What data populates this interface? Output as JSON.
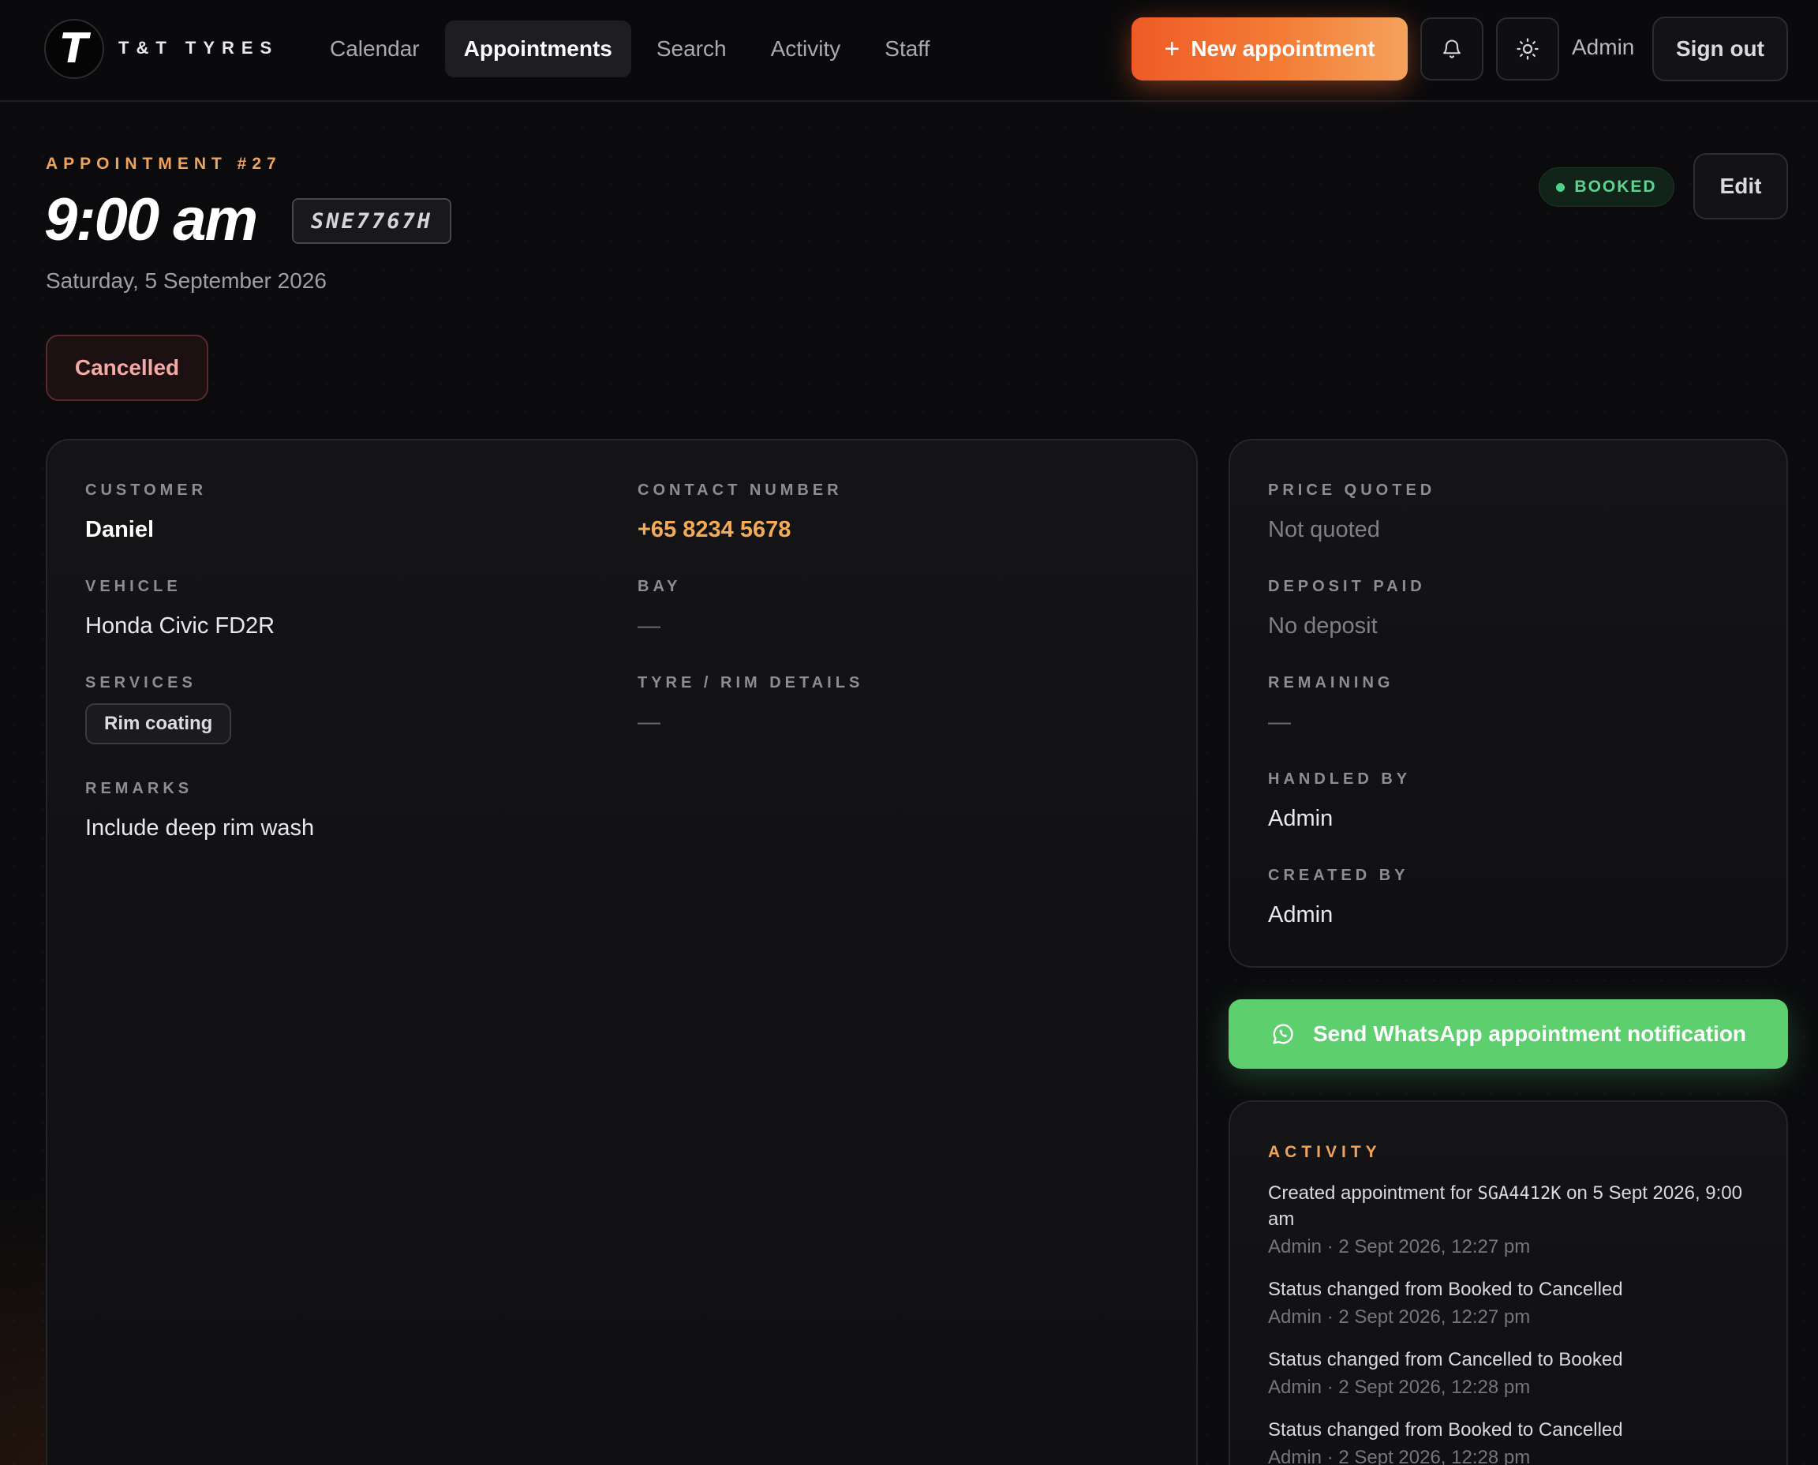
{
  "brand": {
    "logo_letter": "T",
    "name": "T&T TYRES"
  },
  "nav": {
    "items": [
      {
        "label": "Calendar",
        "active": false
      },
      {
        "label": "Appointments",
        "active": true
      },
      {
        "label": "Search",
        "active": false
      },
      {
        "label": "Activity",
        "active": false
      },
      {
        "label": "Staff",
        "active": false
      }
    ],
    "new_appointment_label": "New appointment",
    "user_label": "Admin",
    "sign_out_label": "Sign out"
  },
  "appointment": {
    "eyebrow": "APPOINTMENT #27",
    "time": "9:00 am",
    "plate": "SNE7767H",
    "date": "Saturday, 5 September 2026",
    "action_status_label": "Cancelled",
    "status_badge": "BOOKED",
    "edit_label": "Edit"
  },
  "details": {
    "customer": {
      "label": "CUSTOMER",
      "value": "Daniel"
    },
    "contact": {
      "label": "CONTACT NUMBER",
      "value": "+65 8234 5678"
    },
    "vehicle": {
      "label": "VEHICLE",
      "value": "Honda Civic FD2R"
    },
    "bay": {
      "label": "BAY",
      "value": "—"
    },
    "services": {
      "label": "SERVICES",
      "chips": [
        "Rim coating"
      ]
    },
    "tyre": {
      "label": "TYRE / RIM DETAILS",
      "value": "—"
    },
    "remarks": {
      "label": "REMARKS",
      "value": "Include deep rim wash"
    }
  },
  "side": {
    "price": {
      "label": "PRICE QUOTED",
      "value": "Not quoted"
    },
    "deposit": {
      "label": "DEPOSIT PAID",
      "value": "No deposit"
    },
    "remaining": {
      "label": "REMAINING",
      "value": "—"
    },
    "handled_by": {
      "label": "HANDLED BY",
      "value": "Admin"
    },
    "created_by": {
      "label": "CREATED BY",
      "value": "Admin"
    }
  },
  "whatsapp_label": "Send WhatsApp appointment notification",
  "activity": {
    "title": "ACTIVITY",
    "items": [
      {
        "pre": "Created appointment for ",
        "plate": "SGA4412K",
        "post": " on 5 Sept 2026, 9:00 am",
        "meta": "Admin · 2 Sept 2026, 12:27 pm"
      },
      {
        "pre": "Status changed from Booked to Cancelled",
        "plate": "",
        "post": "",
        "meta": "Admin · 2 Sept 2026, 12:27 pm"
      },
      {
        "pre": "Status changed from Cancelled to Booked",
        "plate": "",
        "post": "",
        "meta": "Admin · 2 Sept 2026, 12:28 pm"
      },
      {
        "pre": "Status changed from Booked to Cancelled",
        "plate": "",
        "post": "",
        "meta": "Admin · 2 Sept 2026, 12:28 pm"
      }
    ]
  },
  "colors": {
    "accent_orange": "#f47d36",
    "booked_green": "#5ed493",
    "whatsapp_green": "#5ecf6e",
    "cancelled_red": "#f4a9a4"
  },
  "icons": {
    "plus": "plus-icon",
    "bell": "bell-icon",
    "theme": "sun-icon",
    "whatsapp": "whatsapp-icon"
  }
}
